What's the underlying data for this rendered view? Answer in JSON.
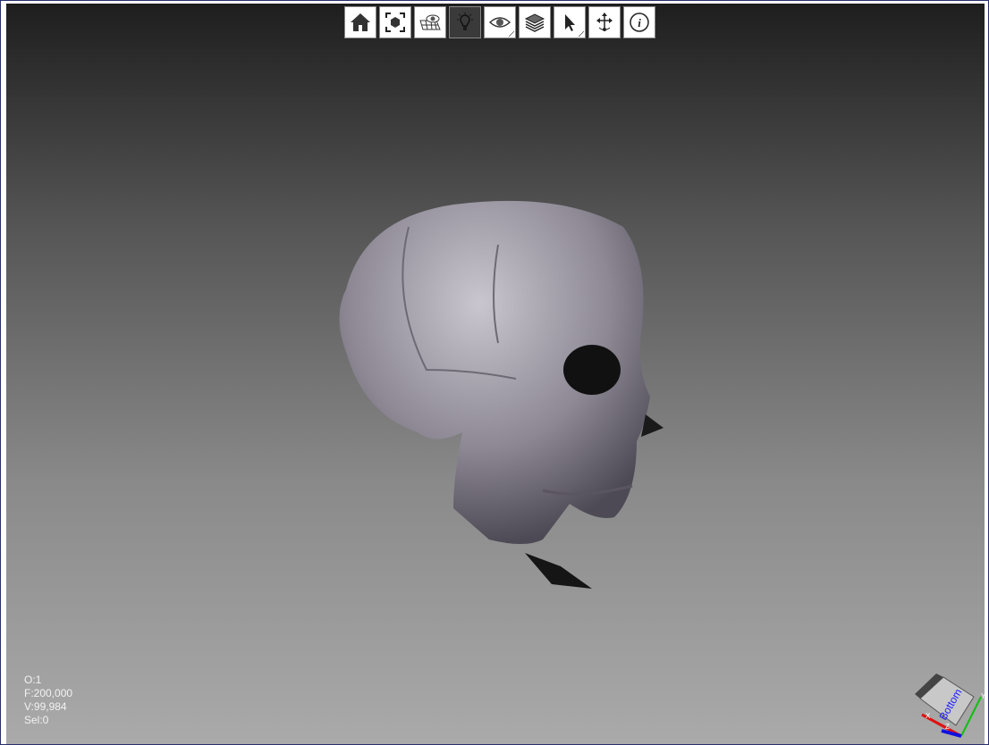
{
  "toolbar": {
    "buttons": [
      {
        "name": "home",
        "icon": "home-icon"
      },
      {
        "name": "zoom-extents",
        "icon": "focus-cube-icon"
      },
      {
        "name": "wireframe-view",
        "icon": "mesh-eye-icon"
      },
      {
        "name": "light",
        "icon": "lightbulb-icon",
        "active": true
      },
      {
        "name": "visibility",
        "icon": "eye-icon"
      },
      {
        "name": "layers",
        "icon": "layers-icon"
      },
      {
        "name": "select",
        "icon": "cursor-arrow-icon"
      },
      {
        "name": "pan",
        "icon": "move-icon"
      },
      {
        "name": "info",
        "icon": "info-icon"
      }
    ]
  },
  "stats": {
    "objects": "O:1",
    "faces": "F:200,000",
    "vertices": "V:99,984",
    "selected": "Sel:0"
  },
  "gizmo": {
    "face_label": "Bottom",
    "axes": [
      "X",
      "Y",
      "Z"
    ]
  },
  "colors": {
    "toolbar_active": "#3a3a3a",
    "axis_x": "#e01010",
    "axis_y": "#10c010",
    "axis_z": "#1010e0"
  }
}
